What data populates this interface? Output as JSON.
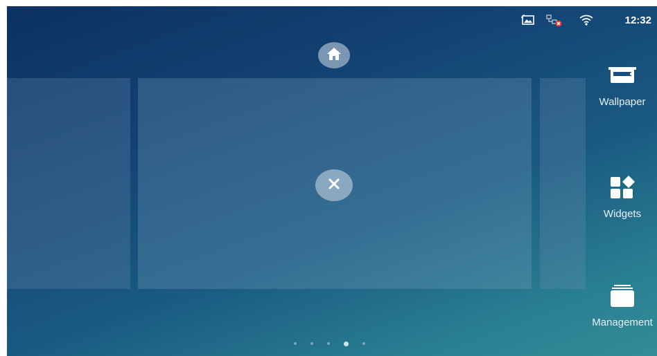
{
  "status_bar": {
    "time": "12:32",
    "icons": [
      "screenshot-icon",
      "network-disconnected-icon",
      "wifi-icon"
    ]
  },
  "home_button": {
    "icon": "home-icon"
  },
  "close_button": {
    "icon": "close-icon"
  },
  "sidebar": {
    "items": [
      {
        "label": "Wallpaper",
        "icon": "wallpaper-icon"
      },
      {
        "label": "Widgets",
        "icon": "widgets-icon"
      },
      {
        "label": "Management",
        "icon": "management-icon"
      }
    ]
  },
  "page_indicator": {
    "count": 5,
    "active_index": 3
  },
  "colors": {
    "background_top": "#0d3163",
    "background_bottom": "#338c96",
    "text": "#ffffff"
  }
}
